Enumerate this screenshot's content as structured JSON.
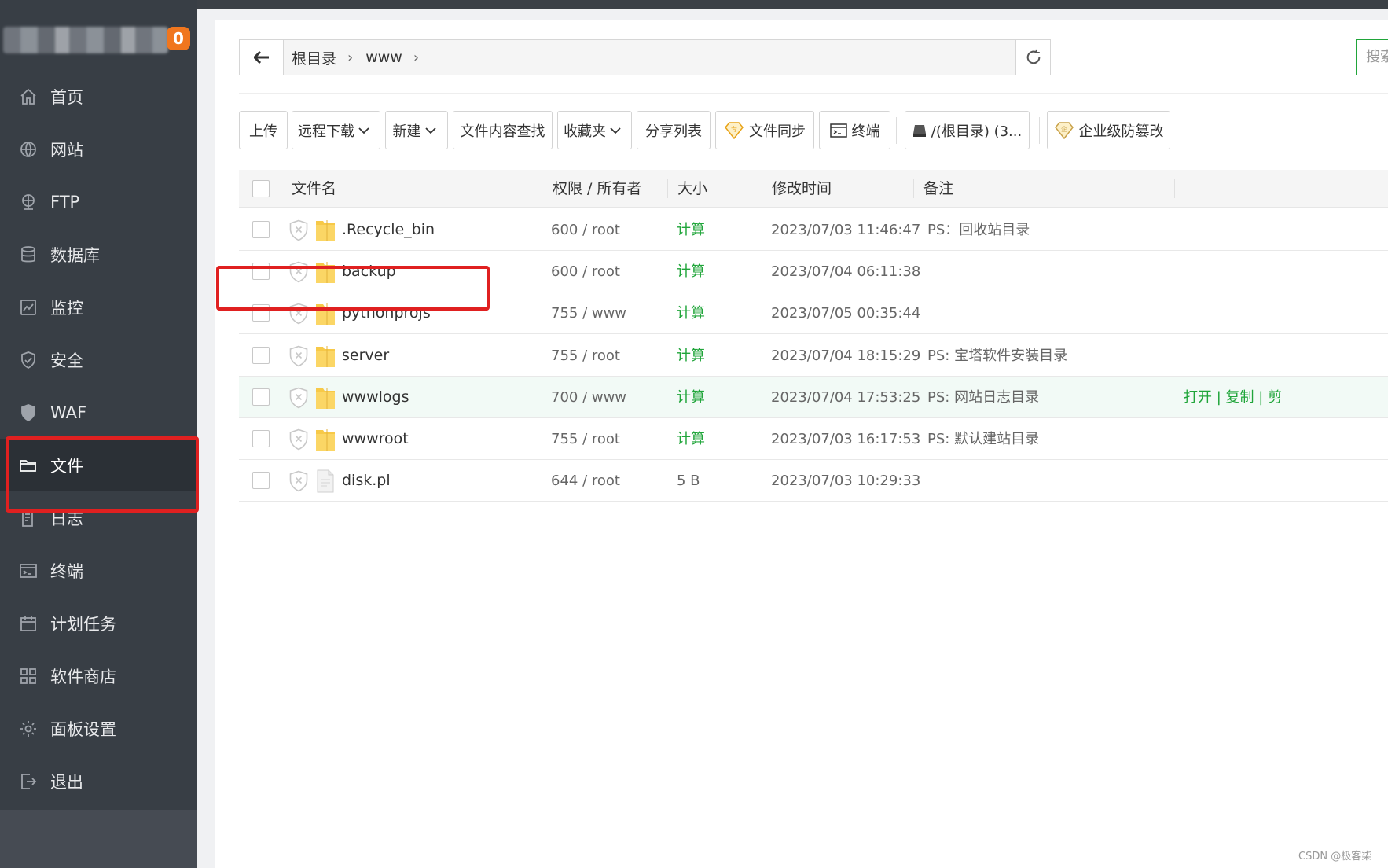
{
  "sidebar": {
    "notification_count": "0",
    "items": [
      {
        "label": "首页",
        "icon": "home-icon"
      },
      {
        "label": "网站",
        "icon": "globe-icon"
      },
      {
        "label": "FTP",
        "icon": "ftp-icon"
      },
      {
        "label": "数据库",
        "icon": "database-icon"
      },
      {
        "label": "监控",
        "icon": "monitor-icon"
      },
      {
        "label": "安全",
        "icon": "shield-icon"
      },
      {
        "label": "WAF",
        "icon": "waf-icon"
      },
      {
        "label": "文件",
        "icon": "folder-icon",
        "active": true
      },
      {
        "label": "日志",
        "icon": "log-icon"
      },
      {
        "label": "终端",
        "icon": "terminal-icon"
      },
      {
        "label": "计划任务",
        "icon": "calendar-icon"
      },
      {
        "label": "软件商店",
        "icon": "apps-icon"
      },
      {
        "label": "面板设置",
        "icon": "gear-icon"
      },
      {
        "label": "退出",
        "icon": "logout-icon"
      }
    ]
  },
  "pathbar": {
    "crumbs": [
      "根目录",
      "www"
    ],
    "search_label": "搜索"
  },
  "toolbar": {
    "upload": "上传",
    "remote_download": "远程下载",
    "new": "新建",
    "content_search": "文件内容查找",
    "favorites": "收藏夹",
    "share_list": "分享列表",
    "file_sync": "文件同步",
    "terminal": "终端",
    "disk": "/(根目录) (3...",
    "tamper_proof": "企业级防篡改"
  },
  "table": {
    "headers": {
      "name": "文件名",
      "perm": "权限 / 所有者",
      "size": "大小",
      "mtime": "修改时间",
      "note": "备注"
    },
    "rows": [
      {
        "name": ".Recycle_bin",
        "type": "folder",
        "perm": "600 / root",
        "size": "计算",
        "mtime": "2023/07/03 11:46:47",
        "note": "PS：回收站目录"
      },
      {
        "name": "backup",
        "type": "folder",
        "perm": "600 / root",
        "size": "计算",
        "mtime": "2023/07/04 06:11:38",
        "note": ""
      },
      {
        "name": "pythonprojs",
        "type": "folder",
        "perm": "755 / www",
        "size": "计算",
        "mtime": "2023/07/05 00:35:44",
        "note": ""
      },
      {
        "name": "server",
        "type": "folder",
        "perm": "755 / root",
        "size": "计算",
        "mtime": "2023/07/04 18:15:29",
        "note": "PS: 宝塔软件安装目录"
      },
      {
        "name": "wwwlogs",
        "type": "folder",
        "perm": "700 / www",
        "size": "计算",
        "mtime": "2023/07/04 17:53:25",
        "note": "PS: 网站日志目录",
        "ops": "打开 | 复制 | 剪"
      },
      {
        "name": "wwwroot",
        "type": "folder",
        "perm": "755 / root",
        "size": "计算",
        "mtime": "2023/07/03 16:17:53",
        "note": "PS: 默认建站目录"
      },
      {
        "name": "disk.pl",
        "type": "file",
        "perm": "644 / root",
        "size": "5 B",
        "mtime": "2023/07/03 10:29:33",
        "note": ""
      }
    ]
  },
  "watermark": "CSDN @极客柒",
  "colors": {
    "sidebar_bg": "#383e45",
    "accent_green": "#20a53a",
    "badge_orange": "#f0761e",
    "highlight_red": "#e02020",
    "folder_yellow": "#f7c948"
  }
}
